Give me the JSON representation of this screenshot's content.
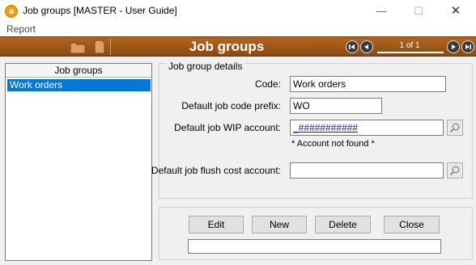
{
  "window": {
    "title": "Job groups [MASTER - User Guide]",
    "app_icon_letter": "a",
    "controls": {
      "minimize": "—",
      "maximize": "☐",
      "close": "✕"
    }
  },
  "menu": {
    "items": [
      "Report"
    ]
  },
  "toolbar": {
    "title": "Job groups",
    "page_indicator": "1 of 1",
    "colors": {
      "background": "#9c5616",
      "text": "#ffffff"
    },
    "icons": [
      "folder-icon",
      "document-icon",
      "first-record-icon",
      "previous-record-icon",
      "next-record-icon",
      "last-record-icon"
    ]
  },
  "list": {
    "header": "Job groups",
    "rows": [
      "Work orders"
    ],
    "selected_index": 0,
    "selection_color": "#0078d7"
  },
  "details": {
    "legend": "Job group details",
    "code_label": "Code:",
    "code_value": "Work orders",
    "prefix_label": "Default job code prefix:",
    "prefix_value": "WO",
    "wip_label": "Default job WIP account:",
    "wip_value": "_###########",
    "wip_warning": "* Account not found *",
    "flush_label": "Default job flush cost account:",
    "flush_value": "",
    "lookup_icon": "magnifier-icon"
  },
  "actions": {
    "edit": "Edit",
    "new": "New",
    "delete": "Delete",
    "close": "Close",
    "status": ""
  }
}
